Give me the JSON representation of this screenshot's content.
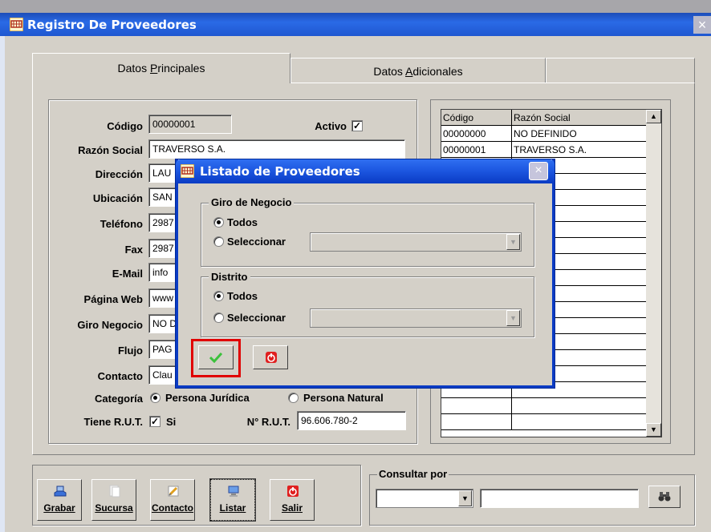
{
  "main_window": {
    "title": "Registro De Proveedores",
    "close": "×"
  },
  "tabs": [
    {
      "label_pre": "Datos ",
      "label_key": "P",
      "label_post": "rincipales"
    },
    {
      "label_pre": "Datos ",
      "label_key": "A",
      "label_post": "dicionales"
    }
  ],
  "form": {
    "codigo_label": "Código",
    "codigo_value": "00000001",
    "activo_label": "Activo",
    "activo_check": "✓",
    "razon_label": "Razón Social",
    "razon_value": "TRAVERSO S.A.",
    "direccion_label": "Dirección",
    "direccion_value": "LAU",
    "ubicacion_label": "Ubicación",
    "ubicacion_value": "SAN",
    "telefono_label": "Teléfono",
    "telefono_value": "2987",
    "fax_label": "Fax",
    "fax_value": "2987",
    "email_label": "E-Mail",
    "email_value": "info",
    "web_label": "Página Web",
    "web_value": "www",
    "giro_label": "Giro Negocio",
    "giro_value": "NO D",
    "flujo_label": "Flujo",
    "flujo_value": "PAG",
    "contacto_label": "Contacto",
    "contacto_value": "Clau",
    "categoria_label": "Categoría",
    "categoria_opt1": "Persona Jurídica",
    "categoria_opt2": "Persona Natural",
    "rut_label": "Tiene R.U.T.",
    "rut_check": "✓",
    "rut_si": "Si",
    "nrut_label": "N° R.U.T.",
    "nrut_value": "96.606.780-2"
  },
  "grid": {
    "headers": [
      "Código",
      "Razón Social"
    ],
    "rows": [
      {
        "code": "00000000",
        "name": "NO DEFINIDO"
      },
      {
        "code": "00000001",
        "name": "TRAVERSO S.A."
      }
    ],
    "scroll_up": "▲",
    "scroll_down": "▼"
  },
  "toolbar": {
    "buttons": [
      {
        "label": "Grabar",
        "icon": "save-icon"
      },
      {
        "label": "Sucursa",
        "icon": "branch-icon"
      },
      {
        "label": "Contacto",
        "icon": "contact-icon"
      },
      {
        "label": "Listar",
        "icon": "list-icon"
      },
      {
        "label": "Salir",
        "icon": "power-icon"
      }
    ]
  },
  "consultar": {
    "label": "Consultar por",
    "combo_arrow": "▼",
    "search_icon": "binoculars-icon"
  },
  "dialog": {
    "title": "Listado de Proveedores",
    "close": "×",
    "giro_legend": "Giro de Negocio",
    "giro_todos": "Todos",
    "giro_seleccionar": "Seleccionar",
    "distrito_legend": "Distrito",
    "distrito_todos": "Todos",
    "distrito_seleccionar": "Seleccionar",
    "combo_arrow": "▼"
  },
  "colors": {
    "titlebar": "#2a6ae6",
    "highlight": "#e00000",
    "ok_green": "#3cc13c",
    "exit_red": "#e02020"
  }
}
